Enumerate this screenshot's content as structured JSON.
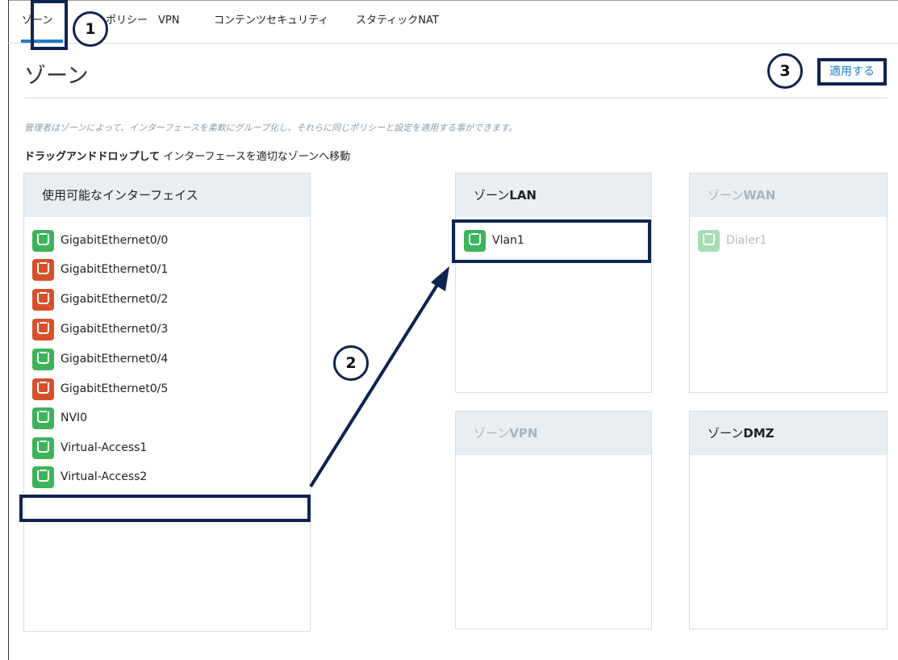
{
  "tabs": [
    {
      "label": "ゾーン",
      "active": true
    },
    {
      "label": "ポリシー",
      "active": false
    },
    {
      "label": "VPN",
      "active": false
    },
    {
      "label": "コンテンツセキュリティ",
      "active": false
    },
    {
      "label": "スタティックNAT",
      "active": false
    }
  ],
  "page": {
    "title": "ゾーン",
    "apply_label": "適用する",
    "description": "管理者はゾーンによって、インターフェースを柔軟にグループ化し、それらに同じポリシーと設定を適用する事ができます。",
    "instruction_bold": "ドラッグアンドドロップして",
    "instruction_rest": " インターフェースを適切なゾーンへ移動"
  },
  "available": {
    "title": "使用可能なインターフェイス",
    "items": [
      {
        "name": "GigabitEthernet0/0",
        "status": "up"
      },
      {
        "name": "GigabitEthernet0/1",
        "status": "down"
      },
      {
        "name": "GigabitEthernet0/2",
        "status": "down"
      },
      {
        "name": "GigabitEthernet0/3",
        "status": "down"
      },
      {
        "name": "GigabitEthernet0/4",
        "status": "up"
      },
      {
        "name": "GigabitEthernet0/5",
        "status": "down"
      },
      {
        "name": "NVI0",
        "status": "up"
      },
      {
        "name": "Virtual-Access1",
        "status": "up"
      },
      {
        "name": "Virtual-Access2",
        "status": "up"
      }
    ]
  },
  "zones": {
    "lan": {
      "prefix": "ゾーン",
      "suffix": "LAN",
      "items": [
        {
          "name": "Vlan1",
          "status": "up"
        }
      ]
    },
    "wan": {
      "prefix": "ゾーン",
      "suffix": "WAN",
      "items": [
        {
          "name": "Dialer1",
          "status": "up"
        }
      ]
    },
    "vpn": {
      "prefix": "ゾーン",
      "suffix": "VPN",
      "items": []
    },
    "dmz": {
      "prefix": "ゾーン",
      "suffix": "DMZ",
      "items": []
    }
  },
  "annotations": {
    "step1": "1",
    "step2": "2",
    "step3": "3"
  },
  "colors": {
    "accent": "#1b7fcc",
    "annotation": "#0e2350",
    "port_up": "#3db35c",
    "port_down": "#d7502a",
    "header_bg": "#e9eef2"
  }
}
